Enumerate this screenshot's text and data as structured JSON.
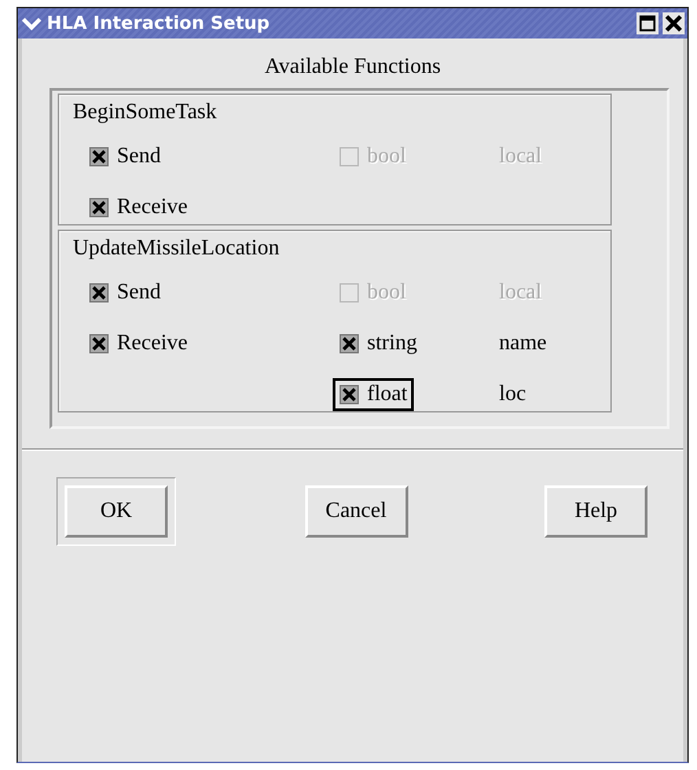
{
  "window": {
    "title": "HLA Interaction Setup"
  },
  "group_title": "Available Functions",
  "functions": [
    {
      "name": "BeginSomeTask",
      "directions": [
        {
          "label": "Send",
          "checked": true
        },
        {
          "label": "Receive",
          "checked": true
        }
      ],
      "params": [
        {
          "type": "bool",
          "name": "local",
          "checked": false,
          "disabled": true,
          "focused": false
        }
      ]
    },
    {
      "name": "UpdateMissileLocation",
      "directions": [
        {
          "label": "Send",
          "checked": true
        },
        {
          "label": "Receive",
          "checked": true
        }
      ],
      "params": [
        {
          "type": "bool",
          "name": "local",
          "checked": false,
          "disabled": true,
          "focused": false
        },
        {
          "type": "string",
          "name": "name",
          "checked": true,
          "disabled": false,
          "focused": false
        },
        {
          "type": "float",
          "name": "loc",
          "checked": true,
          "disabled": false,
          "focused": true
        }
      ]
    }
  ],
  "buttons": [
    {
      "label": "OK",
      "default": true
    },
    {
      "label": "Cancel",
      "default": false
    },
    {
      "label": "Help",
      "default": false
    }
  ]
}
